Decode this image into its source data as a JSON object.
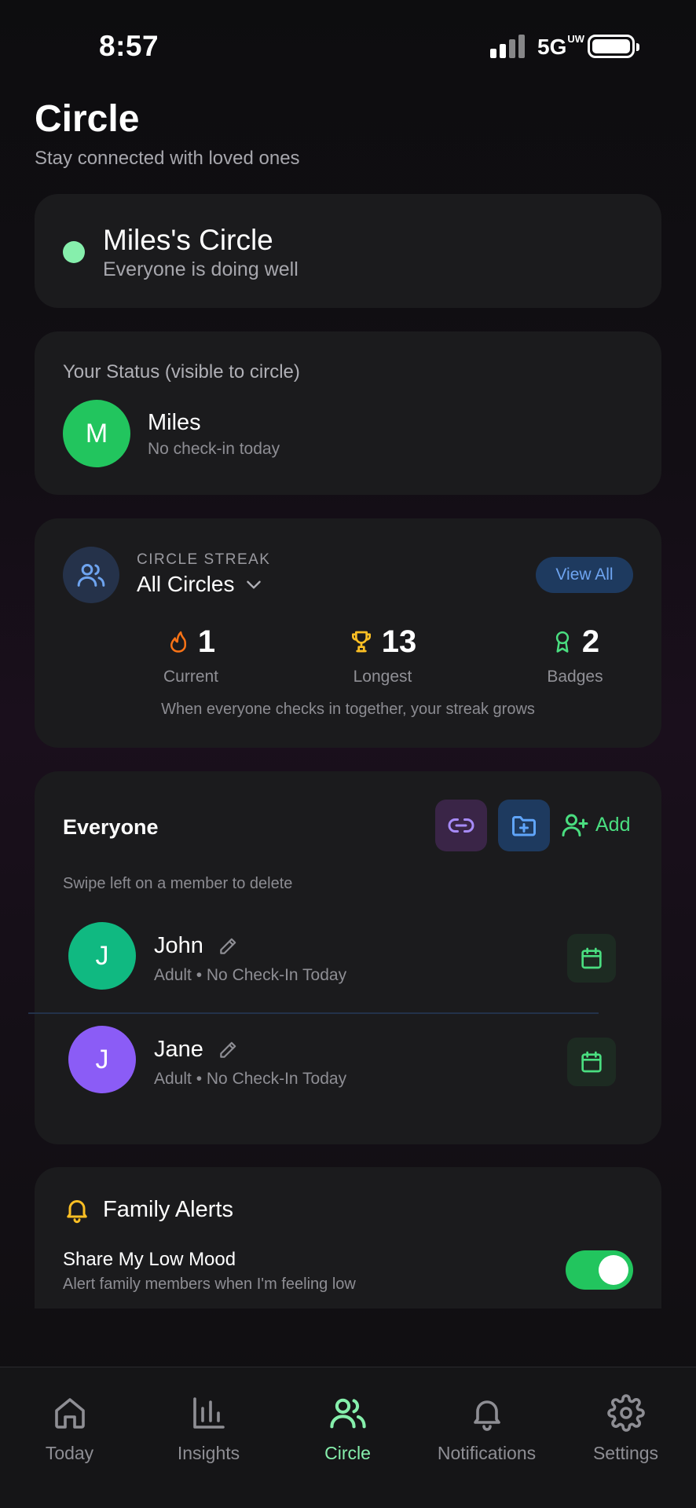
{
  "status_bar": {
    "time": "8:57",
    "network": "5G",
    "network_sub": "UW"
  },
  "header": {
    "title": "Circle",
    "subtitle": "Stay connected with loved ones"
  },
  "circle_card": {
    "title": "Miles's Circle",
    "subtitle": "Everyone is doing well",
    "status_color": "#86efac"
  },
  "your_status": {
    "label": "Your Status (visible to circle)",
    "initial": "M",
    "name": "Miles",
    "status": "No check-in today",
    "avatar_color": "#22c55e"
  },
  "streak": {
    "label": "CIRCLE STREAK",
    "selected": "All Circles",
    "view_all": "View All",
    "stats": [
      {
        "icon": "flame-icon",
        "value": "1",
        "label": "Current",
        "color": "#f97316"
      },
      {
        "icon": "trophy-icon",
        "value": "13",
        "label": "Longest",
        "color": "#fbbf24"
      },
      {
        "icon": "badge-icon",
        "value": "2",
        "label": "Badges",
        "color": "#4ade80"
      }
    ],
    "note": "When everyone checks in together, your streak grows"
  },
  "everyone": {
    "title": "Everyone",
    "add_label": "Add",
    "hint": "Swipe left on a member to delete",
    "members": [
      {
        "initial": "J",
        "name": "John",
        "subtitle": "Adult • No Check-In Today",
        "avatar_color": "#10b981"
      },
      {
        "initial": "J",
        "name": "Jane",
        "subtitle": "Adult • No Check-In Today",
        "avatar_color": "#8b5cf6"
      }
    ]
  },
  "family_alerts": {
    "title": "Family Alerts",
    "toggle_label": "Share My Low Mood",
    "toggle_sub": "Alert family members when I'm feeling low",
    "toggle_on": true
  },
  "tabs": [
    {
      "icon": "home-icon",
      "label": "Today"
    },
    {
      "icon": "bar-chart-icon",
      "label": "Insights"
    },
    {
      "icon": "users-icon",
      "label": "Circle",
      "active": true
    },
    {
      "icon": "bell-icon",
      "label": "Notifications"
    },
    {
      "icon": "gear-icon",
      "label": "Settings"
    }
  ],
  "colors": {
    "accent_green": "#4ade80",
    "active_tab": "#86efac",
    "link_blue": "#6ea4f0"
  }
}
